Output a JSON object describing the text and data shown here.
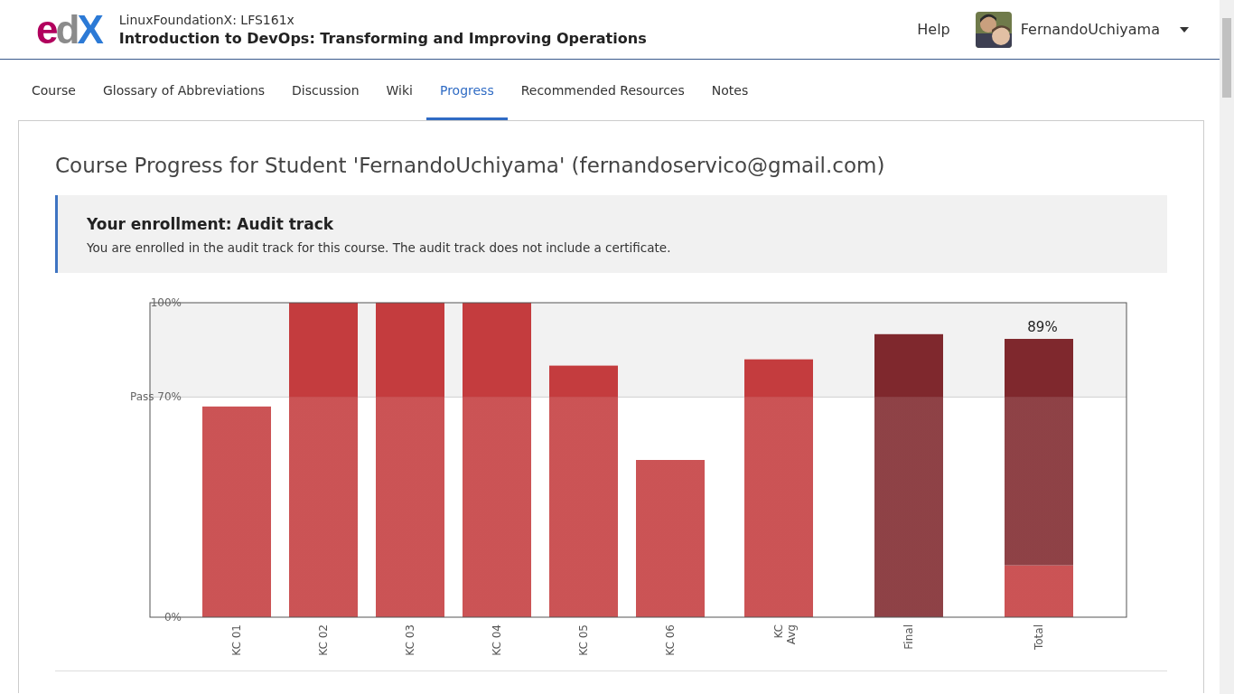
{
  "header": {
    "logo": "edX",
    "org": "LinuxFoundationX: LFS161x",
    "course_title": "Introduction to DevOps: Transforming and Improving Operations",
    "help": "Help",
    "username": "FernandoUchiyama"
  },
  "tabs": [
    {
      "label": "Course",
      "selected": false
    },
    {
      "label": "Glossary of Abbreviations",
      "selected": false
    },
    {
      "label": "Discussion",
      "selected": false
    },
    {
      "label": "Wiki",
      "selected": false
    },
    {
      "label": "Progress",
      "selected": true
    },
    {
      "label": "Recommended Resources",
      "selected": false
    },
    {
      "label": "Notes",
      "selected": false
    }
  ],
  "progress": {
    "heading": "Course Progress for Student 'FernandoUchiyama' (fernandoservico@gmail.com)",
    "enrollment": {
      "title": "Your enrollment: Audit track",
      "message": "You are enrolled in the audit track for this course. The audit track does not include a certificate."
    },
    "chart_data": {
      "type": "bar",
      "stacked": true,
      "categories": [
        "KC 01",
        "KC 02",
        "KC 03",
        "KC 04",
        "KC 05",
        "KC 06",
        "KC Avg",
        "Final",
        "Total"
      ],
      "series": [
        {
          "color": "#c43c3e",
          "values": [
            67,
            100,
            100,
            100,
            80,
            50,
            82,
            null,
            16.5
          ]
        },
        {
          "color": "#7f282d",
          "values": [
            null,
            null,
            null,
            null,
            null,
            null,
            null,
            90,
            72
          ]
        }
      ],
      "ylim": [
        0,
        100
      ],
      "yticks": [
        {
          "value": 0,
          "label": "0%"
        },
        {
          "value": 70,
          "label": "Pass 70%"
        },
        {
          "value": 100,
          "label": "100%"
        }
      ],
      "annotations": [
        "89%"
      ]
    }
  }
}
